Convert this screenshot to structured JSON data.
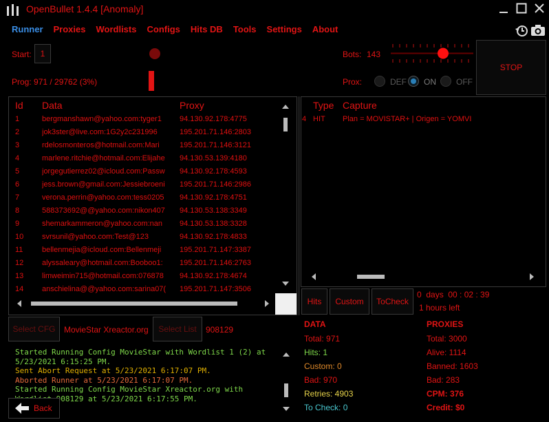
{
  "window": {
    "title": "OpenBullet 1.4.4 [Anomaly]"
  },
  "menu": [
    {
      "label": "Runner",
      "active": true
    },
    {
      "label": "Proxies"
    },
    {
      "label": "Wordlists"
    },
    {
      "label": "Configs"
    },
    {
      "label": "Hits DB"
    },
    {
      "label": "Tools"
    },
    {
      "label": "Settings"
    },
    {
      "label": "About"
    }
  ],
  "runner": {
    "start_label": "Start:",
    "start_value": "1",
    "prog_label": "Prog: 971 / 29762 (3%)",
    "bots_label": "Bots:",
    "bots_value": "143",
    "prox_label": "Prox:",
    "prox_options": [
      "DEF",
      "ON",
      "OFF"
    ],
    "prox_selected": "ON",
    "stop_label": "STOP"
  },
  "data_table": {
    "headers": [
      "Id",
      "Data",
      "Proxy"
    ],
    "rows": [
      {
        "id": "1",
        "data": "bergmanshawn@yahoo.com:tyger1",
        "proxy": "94.130.92.178:4775"
      },
      {
        "id": "2",
        "data": "jok3ster@live.com:1G2y2c231996",
        "proxy": "195.201.71.146:2803"
      },
      {
        "id": "3",
        "data": "rdelosmonteros@hotmail.com:Mari",
        "proxy": "195.201.71.146:3121"
      },
      {
        "id": "4",
        "data": "marlene.ritchie@hotmail.com:Elijahe",
        "proxy": "94.130.53.139:4180"
      },
      {
        "id": "5",
        "data": "jorgegutierrez02@icloud.com:Passw",
        "proxy": "94.130.92.178:4593"
      },
      {
        "id": "6",
        "data": "jess.brown@gmail.com:Jessiebroeni",
        "proxy": "195.201.71.146:2986"
      },
      {
        "id": "7",
        "data": "verona.perrin@yahoo.com:tess0205",
        "proxy": "94.130.92.178:4751"
      },
      {
        "id": "8",
        "data": "588373692@@yahoo.com:nikon407",
        "proxy": "94.130.53.138:3349"
      },
      {
        "id": "9",
        "data": "shemarkammeron@yahoo.com:nan",
        "proxy": "94.130.53.138:3328"
      },
      {
        "id": "10",
        "data": "svrsunil@yahoo.com:Test@123",
        "proxy": "94.130.92.178:4833"
      },
      {
        "id": "11",
        "data": "bellenmejia@icloud.com:Bellenmeji",
        "proxy": "195.201.71.147:3387"
      },
      {
        "id": "12",
        "data": "alyssaleary@hotmail.com:Booboo1:",
        "proxy": "195.201.71.146:2763"
      },
      {
        "id": "13",
        "data": "limweimin715@hotmail.com:076878",
        "proxy": "94.130.92.178:4674"
      },
      {
        "id": "14",
        "data": "anschielina@@yahoo.com:sarina07(",
        "proxy": "195.201.71.147:3506"
      }
    ]
  },
  "capture_table": {
    "headers": [
      "Type",
      "Capture"
    ],
    "rows": [
      {
        "lead": "4",
        "type": "HIT",
        "capture": "Plan = MOVISTAR+ | Origen = YOMVI"
      }
    ]
  },
  "filters": [
    "Hits",
    "Custom",
    "ToCheck"
  ],
  "timer": {
    "elapsed": "0  days  00 : 02 : 39",
    "remaining": "1 hours left"
  },
  "config": {
    "select_cfg": "Select CFG",
    "cfg_name": "MovieStar Xreactor.org",
    "select_list": "Select List",
    "list_name": "908129"
  },
  "log": [
    {
      "text": "Started Running Config MovieStar with Wordlist 1 (2) at\n5/23/2021 6:15:25 PM.",
      "color": "#7fd94a"
    },
    {
      "text": "Sent Abort Request at 5/23/2021 6:17:07 PM.",
      "color": "#e0b000"
    },
    {
      "text": "Aborted Runner at 5/23/2021 6:17:07 PM.",
      "color": "#e56a3a"
    },
    {
      "text": "Started Running Config MovieStar Xreactor.org with\nWordlist 908129 at 5/23/2021 6:17:55 PM.",
      "color": "#7fd94a"
    }
  ],
  "back_label": "Back",
  "stats_data": {
    "title": "DATA",
    "total": "Total:  971",
    "hits": "Hits:  1",
    "custom": "Custom:  0",
    "bad": "Bad:  970",
    "retries": "Retries:  4903",
    "tocheck": "To Check:  0"
  },
  "stats_proxies": {
    "title": "PROXIES",
    "total": "Total:  3000",
    "alive": "Alive:  1114",
    "banned": "Banned:  1603",
    "bad": "Bad:  283",
    "cpm": "CPM:  376",
    "credit": "Credit:  $0"
  },
  "colors": {
    "accent": "#e21414",
    "active_menu": "#3a8ee6",
    "hits_green": "#7fd94a",
    "retries_yellow": "#e8d44a",
    "tocheck_cyan": "#4ac8d0"
  }
}
